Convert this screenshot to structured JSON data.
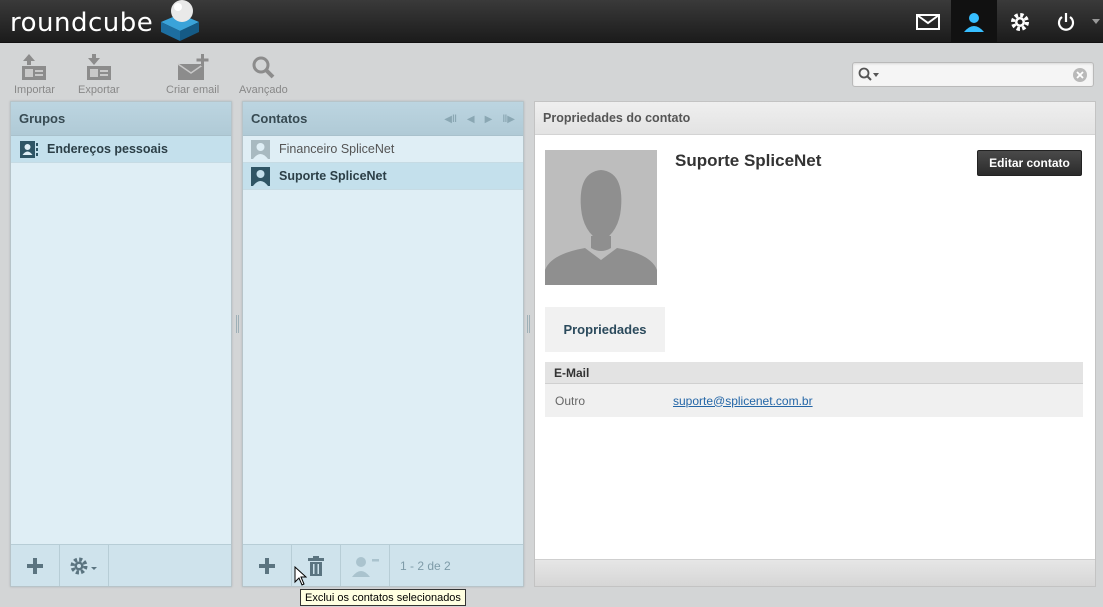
{
  "app": {
    "logo_text": "roundcube"
  },
  "topnav": {
    "items": [
      {
        "name": "mail",
        "icon": "envelope-icon"
      },
      {
        "name": "contacts",
        "icon": "person-icon",
        "active": true
      },
      {
        "name": "settings",
        "icon": "gear-icon"
      },
      {
        "name": "logout",
        "icon": "power-icon"
      }
    ]
  },
  "toolbar": {
    "import_label": "Importar",
    "export_label": "Exportar",
    "compose_label": "Criar email",
    "advanced_label": "Avançado"
  },
  "search": {
    "value": "",
    "placeholder": ""
  },
  "groups": {
    "title": "Grupos",
    "items": [
      {
        "label": "Endereços pessoais",
        "selected": true
      }
    ]
  },
  "contacts": {
    "title": "Contatos",
    "items": [
      {
        "label": "Financeiro SpliceNet",
        "selected": false
      },
      {
        "label": "Suporte SpliceNet",
        "selected": true
      }
    ],
    "count_text": "1 - 2 de 2"
  },
  "details": {
    "title": "Propriedades do contato",
    "contact_name": "Suporte SpliceNet",
    "edit_label": "Editar contato",
    "tab_label": "Propriedades",
    "section_label": "E-Mail",
    "field_label": "Outro",
    "field_value": "suporte@splicenet.com.br"
  },
  "tooltip": {
    "text": "Exclui os contatos selecionados"
  },
  "colors": {
    "accent": "#37beff",
    "header_bg": "#2a2a2a",
    "panel_bg": "#dfeef5"
  }
}
